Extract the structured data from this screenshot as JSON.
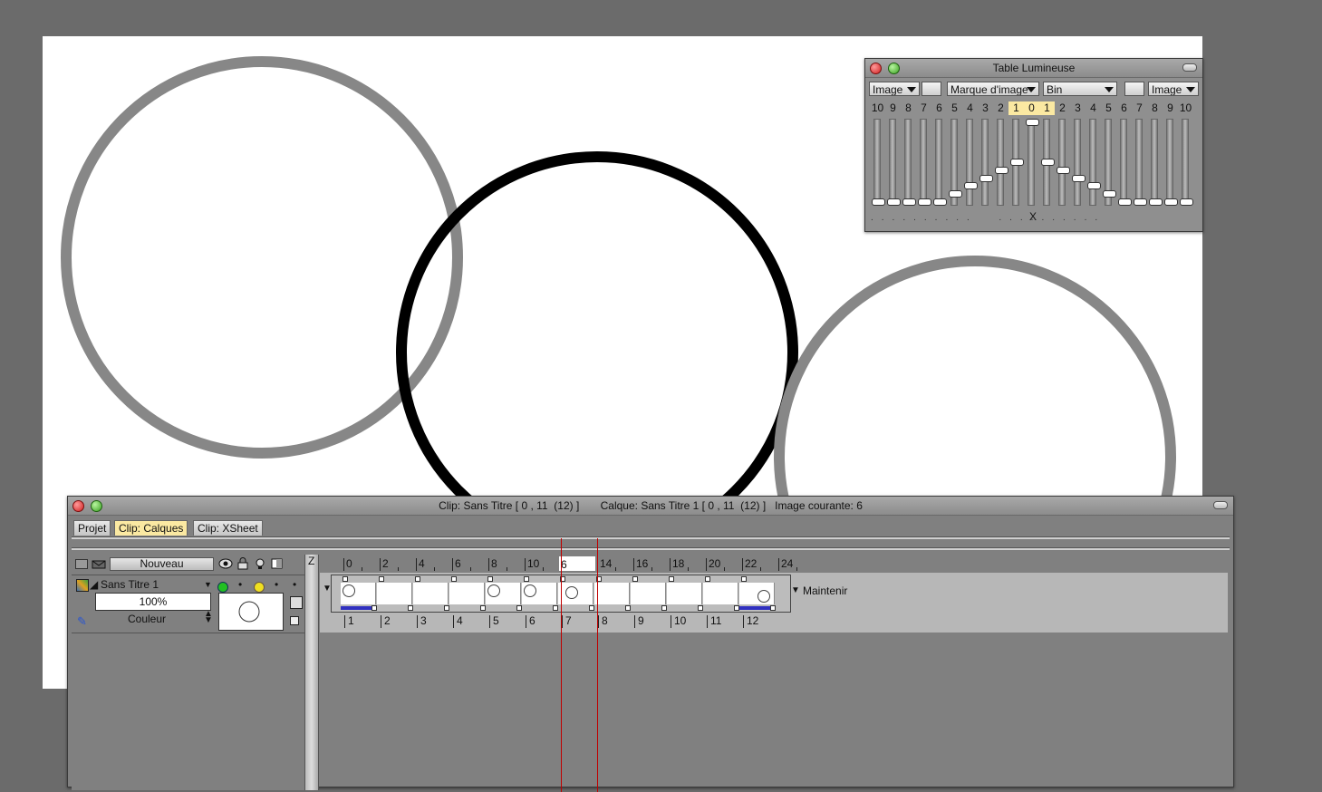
{
  "light_table": {
    "title": "Table Lumineuse",
    "dropdowns": {
      "left_mode": "Image",
      "marker": "Marque d'image",
      "bin": "Bin",
      "right_mode": "Image"
    },
    "left_numbers": [
      "10",
      "9",
      "8",
      "7",
      "6",
      "5",
      "4",
      "3",
      "2",
      "1"
    ],
    "center_number": "0",
    "right_numbers": [
      "1",
      "2",
      "3",
      "4",
      "5",
      "6",
      "7",
      "8",
      "9",
      "10"
    ],
    "center_mark": "X",
    "left_slider_levels": [
      0,
      0,
      0,
      0,
      0,
      0.1,
      0.2,
      0.3,
      0.4,
      0.5
    ],
    "center_slider_level": 1,
    "right_slider_levels": [
      0.5,
      0.4,
      0.3,
      0.2,
      0.1,
      0,
      0,
      0,
      0,
      0
    ]
  },
  "timeline": {
    "title": "Clip: Sans Titre [ 0 , 11  (12) ]       Calque: Sans Titre 1 [ 0 , 11  (12) ]   Image courante: 6",
    "tabs": [
      {
        "label": "Projet",
        "active": false
      },
      {
        "label": "Clip: Calques",
        "active": true
      },
      {
        "label": "Clip: XSheet",
        "active": false
      }
    ],
    "new_button": "Nouveau",
    "z_label": "Z",
    "layer": {
      "name": "Sans Titre 1",
      "opacity": "100%",
      "mode": "Couleur"
    },
    "ruler_labels": [
      "0",
      "2",
      "4",
      "6",
      "8",
      "10",
      "12",
      "14",
      "16",
      "18",
      "20",
      "22",
      "24"
    ],
    "current_frame_label": "6",
    "frame_numbers": [
      "1",
      "2",
      "3",
      "4",
      "5",
      "6",
      "7",
      "8",
      "9",
      "10",
      "11",
      "12"
    ],
    "hold_label": "Maintenir"
  },
  "colors": {
    "highlight": "#fbe9a2",
    "current_line": "#c00000",
    "canvas": "#ffffff",
    "workspace": "#6b6b6b"
  }
}
